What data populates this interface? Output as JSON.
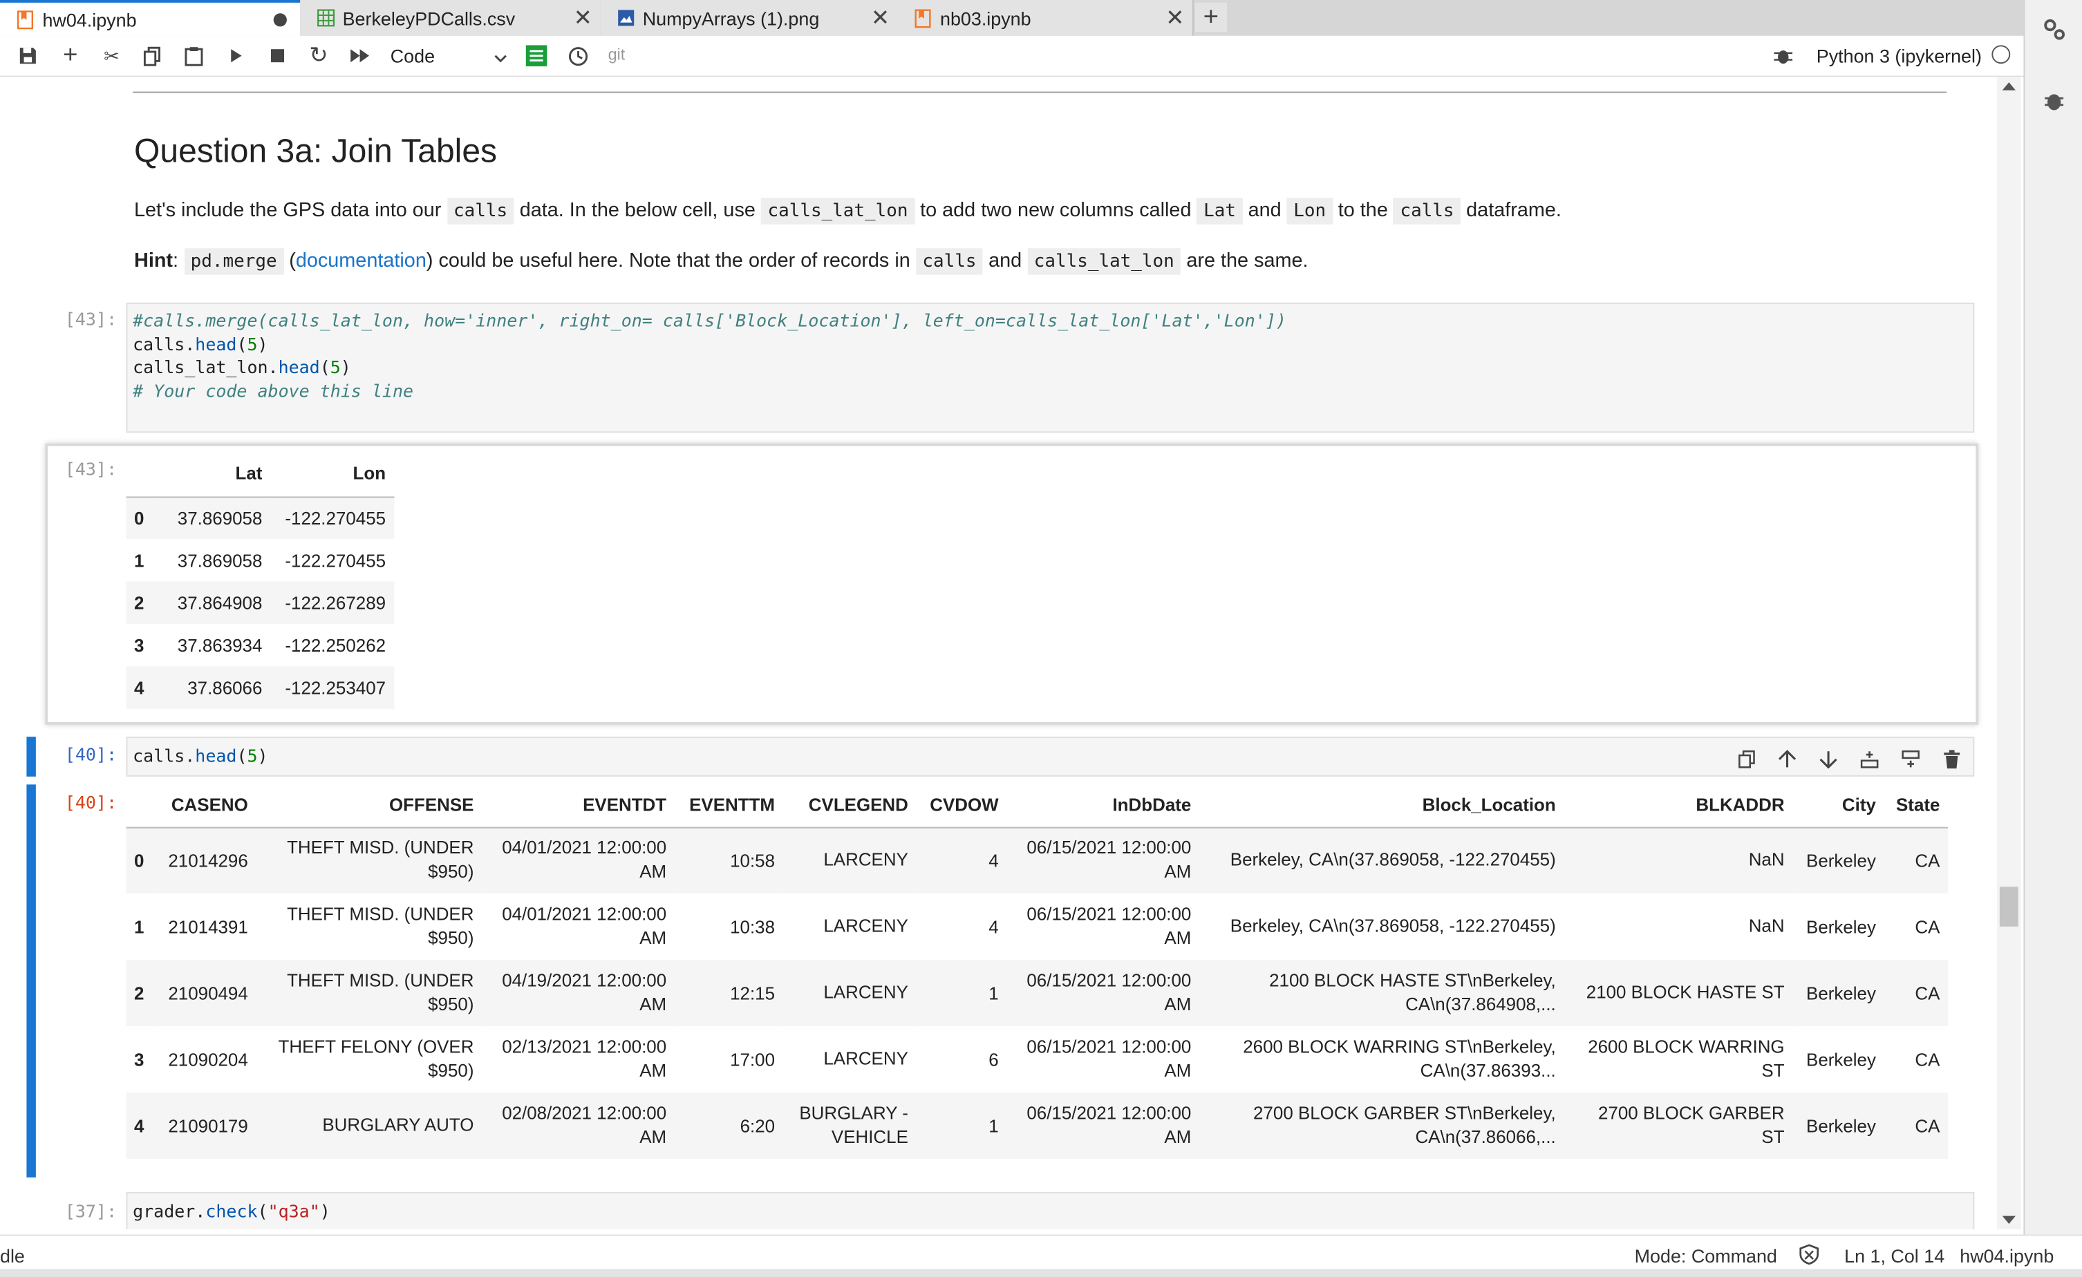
{
  "tabs": [
    {
      "label": "hw04.ipynb",
      "icon": "notebook-icon",
      "active": true
    },
    {
      "label": "BerkeleyPDCalls.csv",
      "icon": "spreadsheet-icon"
    },
    {
      "label": "NumpyArrays (1).png",
      "icon": "image-icon"
    },
    {
      "label": "nb03.ipynb",
      "icon": "notebook-icon"
    }
  ],
  "toolbar": {
    "cell_type": "Code",
    "git": "git",
    "kernel": "Python 3 (ipykernel)"
  },
  "markdown": {
    "heading": "Question 3a: Join Tables",
    "p1": {
      "t1": "Let's include the GPS data into our ",
      "c1": "calls",
      "t2": " data. In the below cell, use ",
      "c2": "calls_lat_lon",
      "t3": " to add two new columns called ",
      "c3": "Lat",
      "t4": " and ",
      "c4": "Lon",
      "t5": " to the ",
      "c5": "calls",
      "t6": " dataframe."
    },
    "p2": {
      "bold": "Hint",
      "t1": ": ",
      "c1": "pd.merge",
      "t2": " (",
      "link": "documentation",
      "t3": ") could be useful here. Note that the order of records in ",
      "c2": "calls",
      "t4": " and ",
      "c3": "calls_lat_lon",
      "t5": " are the same."
    }
  },
  "cell43": {
    "prompt": "[43]:",
    "lines": {
      "l1": "#calls.merge(calls_lat_lon, how='inner', right_on= calls['Block_Location'], left_on=calls_lat_lon['Lat','Lon'])",
      "l2a": "calls.",
      "l2b": "head",
      "l2c": "(",
      "l2d": "5",
      "l2e": ")",
      "l3a": "calls_lat_lon.",
      "l3b": "head",
      "l3c": "(",
      "l3d": "5",
      "l3e": ")",
      "l4": "# Your code above this line"
    }
  },
  "out43": {
    "prompt": "[43]:",
    "columns": [
      "",
      "Lat",
      "Lon"
    ],
    "rows": [
      [
        "0",
        "37.869058",
        "-122.270455"
      ],
      [
        "1",
        "37.869058",
        "-122.270455"
      ],
      [
        "2",
        "37.864908",
        "-122.267289"
      ],
      [
        "3",
        "37.863934",
        "-122.250262"
      ],
      [
        "4",
        "37.86066",
        "-122.253407"
      ]
    ]
  },
  "cell40": {
    "prompt": "[40]:",
    "code": {
      "a": "calls.",
      "b": "head",
      "c": "(",
      "d": "5",
      "e": ")"
    }
  },
  "out40": {
    "prompt": "[40]:",
    "columns": [
      "",
      "CASENO",
      "OFFENSE",
      "EVENTDT",
      "EVENTTM",
      "CVLEGEND",
      "CVDOW",
      "InDbDate",
      "Block_Location",
      "BLKADDR",
      "City",
      "State"
    ],
    "rows": [
      {
        "idx": "0",
        "caseno": "21014296",
        "offense": [
          "THEFT MISD. (UNDER",
          "$950)"
        ],
        "eventdt": [
          "04/01/2021 12:00:00",
          "AM"
        ],
        "eventtm": "10:58",
        "cvlegend": [
          "LARCENY"
        ],
        "cvdow": "4",
        "indbdate": [
          "06/15/2021 12:00:00",
          "AM"
        ],
        "block": [
          "Berkeley, CA\\n(37.869058, -122.270455)"
        ],
        "blkaddr": [
          "NaN"
        ],
        "city": "Berkeley",
        "state": "CA"
      },
      {
        "idx": "1",
        "caseno": "21014391",
        "offense": [
          "THEFT MISD. (UNDER",
          "$950)"
        ],
        "eventdt": [
          "04/01/2021 12:00:00",
          "AM"
        ],
        "eventtm": "10:38",
        "cvlegend": [
          "LARCENY"
        ],
        "cvdow": "4",
        "indbdate": [
          "06/15/2021 12:00:00",
          "AM"
        ],
        "block": [
          "Berkeley, CA\\n(37.869058, -122.270455)"
        ],
        "blkaddr": [
          "NaN"
        ],
        "city": "Berkeley",
        "state": "CA"
      },
      {
        "idx": "2",
        "caseno": "21090494",
        "offense": [
          "THEFT MISD. (UNDER",
          "$950)"
        ],
        "eventdt": [
          "04/19/2021 12:00:00",
          "AM"
        ],
        "eventtm": "12:15",
        "cvlegend": [
          "LARCENY"
        ],
        "cvdow": "1",
        "indbdate": [
          "06/15/2021 12:00:00",
          "AM"
        ],
        "block": [
          "2100 BLOCK HASTE ST\\nBerkeley,",
          "CA\\n(37.864908,..."
        ],
        "blkaddr": [
          "2100 BLOCK HASTE ST"
        ],
        "city": "Berkeley",
        "state": "CA"
      },
      {
        "idx": "3",
        "caseno": "21090204",
        "offense": [
          "THEFT FELONY (OVER",
          "$950)"
        ],
        "eventdt": [
          "02/13/2021 12:00:00",
          "AM"
        ],
        "eventtm": "17:00",
        "cvlegend": [
          "LARCENY"
        ],
        "cvdow": "6",
        "indbdate": [
          "06/15/2021 12:00:00",
          "AM"
        ],
        "block": [
          "2600 BLOCK WARRING ST\\nBerkeley,",
          "CA\\n(37.86393..."
        ],
        "blkaddr": [
          "2600 BLOCK WARRING",
          "ST"
        ],
        "city": "Berkeley",
        "state": "CA"
      },
      {
        "idx": "4",
        "caseno": "21090179",
        "offense": [
          "BURGLARY AUTO"
        ],
        "eventdt": [
          "02/08/2021 12:00:00",
          "AM"
        ],
        "eventtm": "6:20",
        "cvlegend": [
          "BURGLARY -",
          "VEHICLE"
        ],
        "cvdow": "1",
        "indbdate": [
          "06/15/2021 12:00:00",
          "AM"
        ],
        "block": [
          "2700 BLOCK GARBER ST\\nBerkeley,",
          "CA\\n(37.86066,..."
        ],
        "blkaddr": [
          "2700 BLOCK GARBER",
          "ST"
        ],
        "city": "Berkeley",
        "state": "CA"
      }
    ]
  },
  "cell37": {
    "prompt": "[37]:",
    "code": {
      "a": "grader.",
      "b": "check",
      "c": "(",
      "d": "\"q3a\"",
      "e": ")"
    }
  },
  "status": {
    "left": "dle",
    "mode": "Mode: Command",
    "position": "Ln 1, Col 14",
    "file": "hw04.ipynb"
  },
  "colors": {
    "accent": "#1976d2",
    "out_prompt": "#d84315",
    "in_prompt": "#3266c4"
  }
}
